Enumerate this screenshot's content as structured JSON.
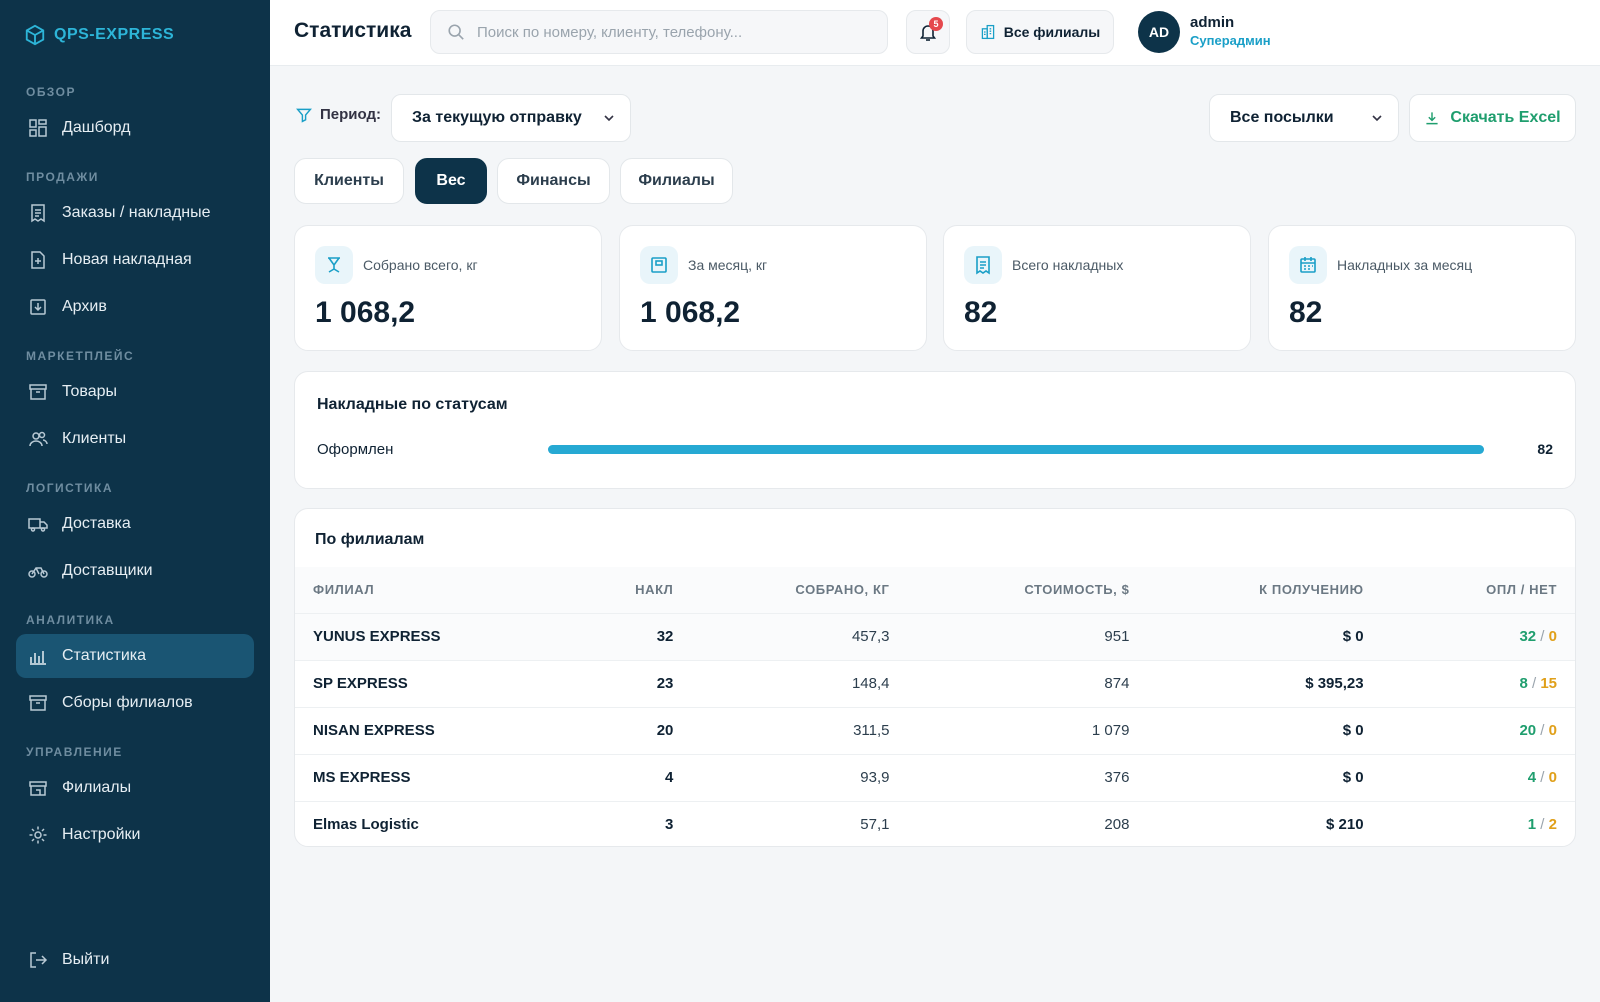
{
  "app": {
    "logo_text": "QPS-EXPRESS"
  },
  "sidebar": {
    "sections": [
      {
        "title": "ОБЗОР",
        "items": [
          {
            "label": "Дашборд",
            "icon": "grid-icon"
          }
        ]
      },
      {
        "title": "ПРОДАЖИ",
        "items": [
          {
            "label": "Заказы / накладные",
            "icon": "invoice-icon"
          },
          {
            "label": "Новая накладная",
            "icon": "file-plus-icon"
          },
          {
            "label": "Архив",
            "icon": "archive-icon"
          }
        ]
      },
      {
        "title": "МАРКЕТПЛЕЙС",
        "items": [
          {
            "label": "Товары",
            "icon": "box-icon"
          },
          {
            "label": "Клиенты",
            "icon": "users-icon"
          }
        ]
      },
      {
        "title": "ЛОГИСТИКА",
        "items": [
          {
            "label": "Доставка",
            "icon": "truck-icon"
          },
          {
            "label": "Доставщики",
            "icon": "bike-icon"
          }
        ]
      },
      {
        "title": "АНАЛИТИКА",
        "items": [
          {
            "label": "Статистика",
            "icon": "chart-icon",
            "active": true
          },
          {
            "label": "Сборы филиалов",
            "icon": "box-icon"
          }
        ]
      },
      {
        "title": "УПРАВЛЕНИЕ",
        "items": [
          {
            "label": "Филиалы",
            "icon": "store-icon"
          },
          {
            "label": "Настройки",
            "icon": "gear-icon"
          }
        ]
      }
    ],
    "logout_label": "Выйти"
  },
  "header": {
    "title": "Статистика",
    "search_placeholder": "Поиск по номеру, клиенту, телефону...",
    "notification_count": "5",
    "branches_label": "Все филиалы",
    "avatar_initials": "AD",
    "user_name": "admin",
    "user_role": "Суперадмин"
  },
  "filters": {
    "period_label": "Период:",
    "period_value": "За текущую отправку",
    "parcels_value": "Все посылки",
    "excel_label": "Скачать Excel"
  },
  "tabs": [
    {
      "label": "Клиенты",
      "active": false
    },
    {
      "label": "Вес",
      "active": true
    },
    {
      "label": "Финансы",
      "active": false
    },
    {
      "label": "Филиалы",
      "active": false
    }
  ],
  "cards": [
    {
      "label": "Собрано всего, кг",
      "value": "1 068,2",
      "icon": "scale-icon"
    },
    {
      "label": "За месяц, кг",
      "value": "1 068,2",
      "icon": "calendar-box-icon"
    },
    {
      "label": "Всего накладных",
      "value": "82",
      "icon": "invoice-icon"
    },
    {
      "label": "Накладных за месяц",
      "value": "82",
      "icon": "calendar-icon"
    }
  ],
  "status_panel": {
    "title": "Накладные по статусам",
    "items": [
      {
        "label": "Оформлен",
        "count": "82",
        "fill": 1.0
      }
    ]
  },
  "branches_table": {
    "title": "По филиалам",
    "columns": [
      "ФИЛИАЛ",
      "НАКЛ",
      "СОБРАНО, КГ",
      "СТОИМОСТЬ, $",
      "К ПОЛУЧЕНИЮ",
      "ОПЛ / НЕТ"
    ],
    "rows": [
      {
        "name": "YUNUS EXPRESS",
        "count": "32",
        "weight": "457,3",
        "cost": "951",
        "receivable": "$ 0",
        "paid": "32",
        "unpaid": "0"
      },
      {
        "name": "SP EXPRESS",
        "count": "23",
        "weight": "148,4",
        "cost": "874",
        "receivable": "$ 395,23",
        "paid": "8",
        "unpaid": "15"
      },
      {
        "name": "NISAN EXPRESS",
        "count": "20",
        "weight": "311,5",
        "cost": "1 079",
        "receivable": "$ 0",
        "paid": "20",
        "unpaid": "0"
      },
      {
        "name": "MS EXPRESS",
        "count": "4",
        "weight": "93,9",
        "cost": "376",
        "receivable": "$ 0",
        "paid": "4",
        "unpaid": "0"
      },
      {
        "name": "Elmas Logistic",
        "count": "3",
        "weight": "57,1",
        "cost": "208",
        "receivable": "$ 210",
        "paid": "1",
        "unpaid": "2"
      }
    ]
  },
  "colors": {
    "sidebar_bg": "#0d3349",
    "accent": "#26a9d3",
    "paid": "#1f9e6e",
    "unpaid": "#e0a01a"
  }
}
